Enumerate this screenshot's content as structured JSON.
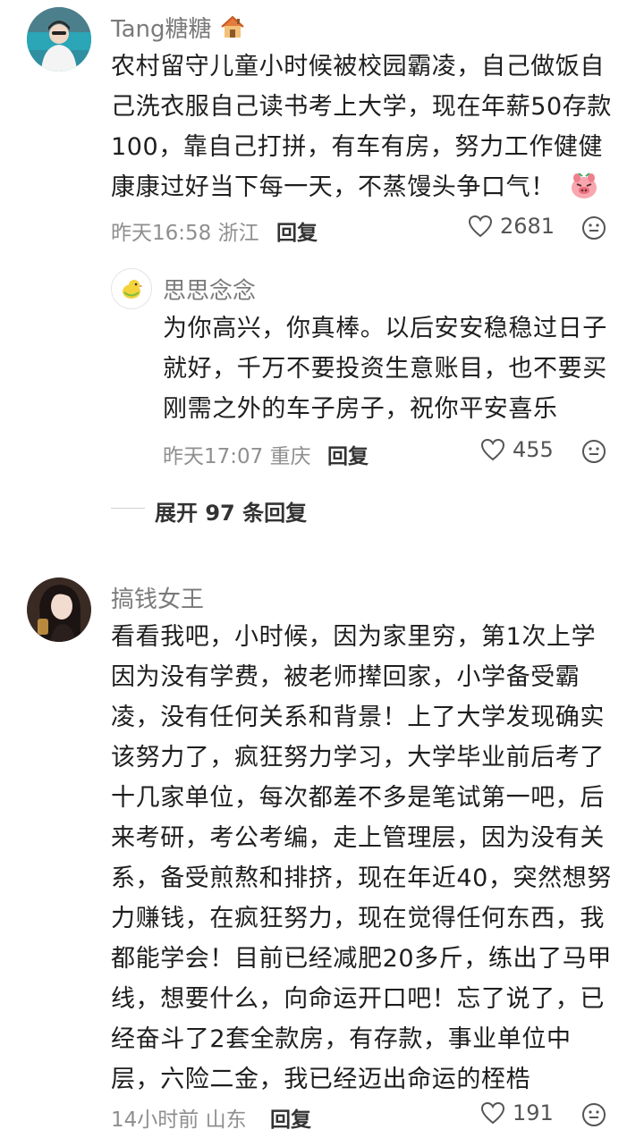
{
  "comments": [
    {
      "user": "Tang糖糖",
      "badge_icon": "house-emoji",
      "text": "农村留守儿童小时候被校园霸凌，自己做饭自己洗衣服自己读书考上大学，现在年薪50存款100，靠自己打拼，有车有房，努力工作健健康康过好当下每一天，不蒸馒头争口气！",
      "time": "昨天16:58",
      "location": "浙江",
      "reply_label": "回复",
      "likes": "2681",
      "replies": [
        {
          "user": "思思念念",
          "text": "为你高兴，你真棒。以后安安稳稳过日子就好，千万不要投资生意账目，也不要买刚需之外的车子房子，祝你平安喜乐",
          "time": "昨天17:07",
          "location": "重庆",
          "reply_label": "回复",
          "likes": "455"
        }
      ],
      "expand_label": "展开 97 条回复"
    },
    {
      "user": "搞钱女王",
      "text": "看看我吧，小时候，因为家里穷，第1次上学因为没有学费，被老师撵回家，小学备受霸凌，没有任何关系和背景！上了大学发现确实该努力了，疯狂努力学习，大学毕业前后考了十几家单位，每次都差不多是笔试第一吧，后来考研，考公考编，走上管理层，因为没有关系，备受煎熬和排挤，现在年近40，突然想努力赚钱，在疯狂努力，现在觉得任何东西，我都能学会！目前已经减肥20多斤，练出了马甲线，想要什么，向命运开口吧！忘了说了，已经奋斗了2套全款房，有存款，事业单位中层，六险二金，我已经迈出命运的桎梏",
      "time": "14小时前",
      "location": "山东",
      "reply_label": "回复",
      "likes": "191"
    }
  ]
}
